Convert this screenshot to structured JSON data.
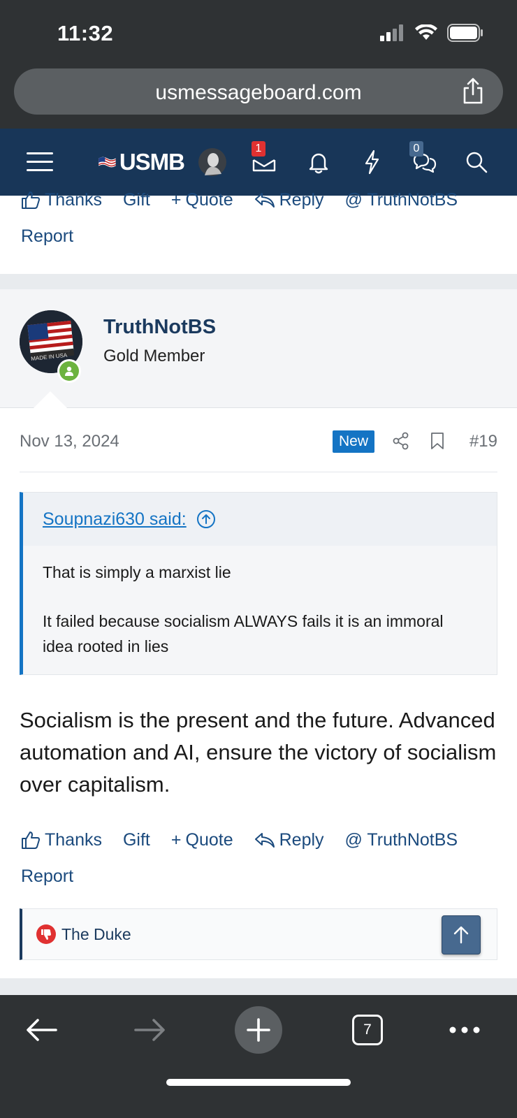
{
  "status": {
    "time": "11:32"
  },
  "browser": {
    "url": "usmessageboard.com",
    "tabs_count": "7"
  },
  "nav": {
    "logo": "USMB",
    "inbox_count": "1",
    "conversations_count": "0"
  },
  "prev_post_actions": {
    "thanks": "Thanks",
    "gift": "Gift",
    "quote": "Quote",
    "reply": "Reply",
    "mention": "@ TruthNotBS",
    "report": "Report"
  },
  "post": {
    "author": "TruthNotBS",
    "author_title": "Gold Member",
    "date": "Nov 13, 2024",
    "new_label": "New",
    "number": "#19",
    "quote": {
      "author": "Soupnazi630 said:",
      "paragraphs": [
        "That is simply a marxist lie",
        "It failed because socialism ALWAYS fails it is an immoral idea rooted in lies"
      ]
    },
    "body": "Socialism is the present and the future. Advanced automation and AI, ensure the victory of socialism over capitalism.",
    "actions": {
      "thanks": "Thanks",
      "gift": "Gift",
      "quote": "Quote",
      "reply": "Reply",
      "mention": "@ TruthNotBS",
      "report": "Report"
    },
    "reactions": {
      "users": "The Duke"
    }
  },
  "colors": {
    "nav_bg": "#183658",
    "link": "#1b4a7d",
    "accent": "#1474c4",
    "dislike": "#e03131"
  }
}
